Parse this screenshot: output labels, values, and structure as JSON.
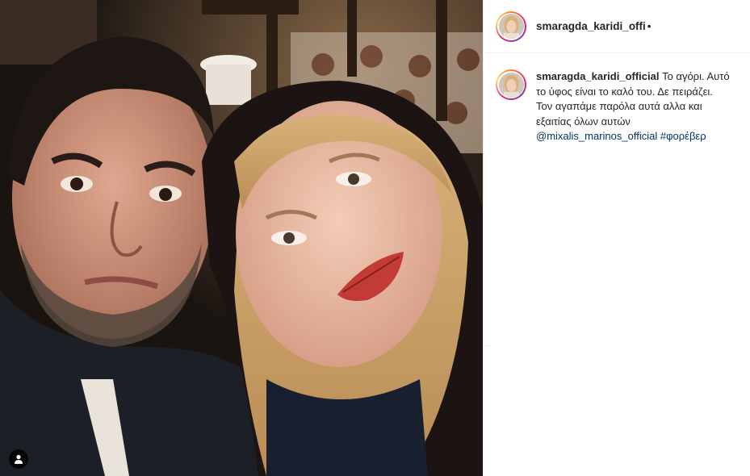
{
  "post": {
    "header": {
      "username": "smaragda_karidi_ofﬁ",
      "separator": "•"
    },
    "caption": {
      "username": "smaragda_karidi_official",
      "text": " Το αγόρι. Αυτό το ύφος είναι το καλό του. Δε πειράζει. Τον αγαπάμε παρόλα αυτά αλλα και εξαιτίας όλων αυτών ",
      "mention": "@mixalis_marinos_official",
      "space": " ",
      "hashtag": "#φορέβερ"
    },
    "icons": {
      "tag": "user-tag-icon",
      "avatar": "profile-avatar"
    },
    "colors": {
      "link": "#003569",
      "text": "#262626",
      "border": "#efefef",
      "ring_start": "#f58529",
      "ring_mid": "#dd2a7b",
      "ring_end": "#8134af"
    }
  }
}
